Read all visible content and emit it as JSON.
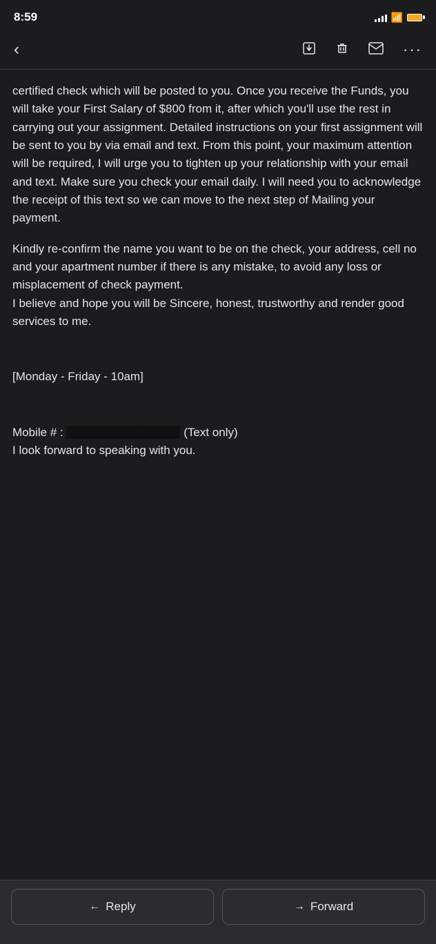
{
  "status": {
    "time": "8:59",
    "signal_bars": [
      3,
      6,
      9,
      12,
      14
    ],
    "wifi": "wifi",
    "battery": "battery"
  },
  "toolbar": {
    "back_label": "<",
    "download_icon": "⬇",
    "trash_icon": "🗑",
    "mail_icon": "✉",
    "more_icon": "···"
  },
  "email": {
    "body_paragraph1": "certified check which will be posted to you. Once you receive the Funds, you will take your First Salary of $800 from it, after which you'll use the rest in carrying out your assignment. Detailed instructions on your first assignment will be sent to you by via email and text. From this point, your maximum attention will be required, I will urge you to tighten up your relationship with your email and text. Make sure you check your email daily. I will need you to acknowledge the receipt of this text so we can move to the next step of Mailing your payment.",
    "body_paragraph2": "Kindly re-confirm the name you want to be on the check, your address, cell no and your apartment number if there is any mistake, to avoid any loss or misplacement of check payment.\nI believe and hope you will be Sincere, honest, trustworthy and render good services to me.",
    "schedule": "[Monday - Friday  - 10am]",
    "mobile_label": "Mobile #   :",
    "mobile_redacted": "REDACTED",
    "mobile_suffix": "(Text only)",
    "closing": "I look forward to speaking with you."
  },
  "actions": {
    "reply_label": "Reply",
    "reply_icon": "←",
    "forward_label": "Forward",
    "forward_icon": "→"
  }
}
